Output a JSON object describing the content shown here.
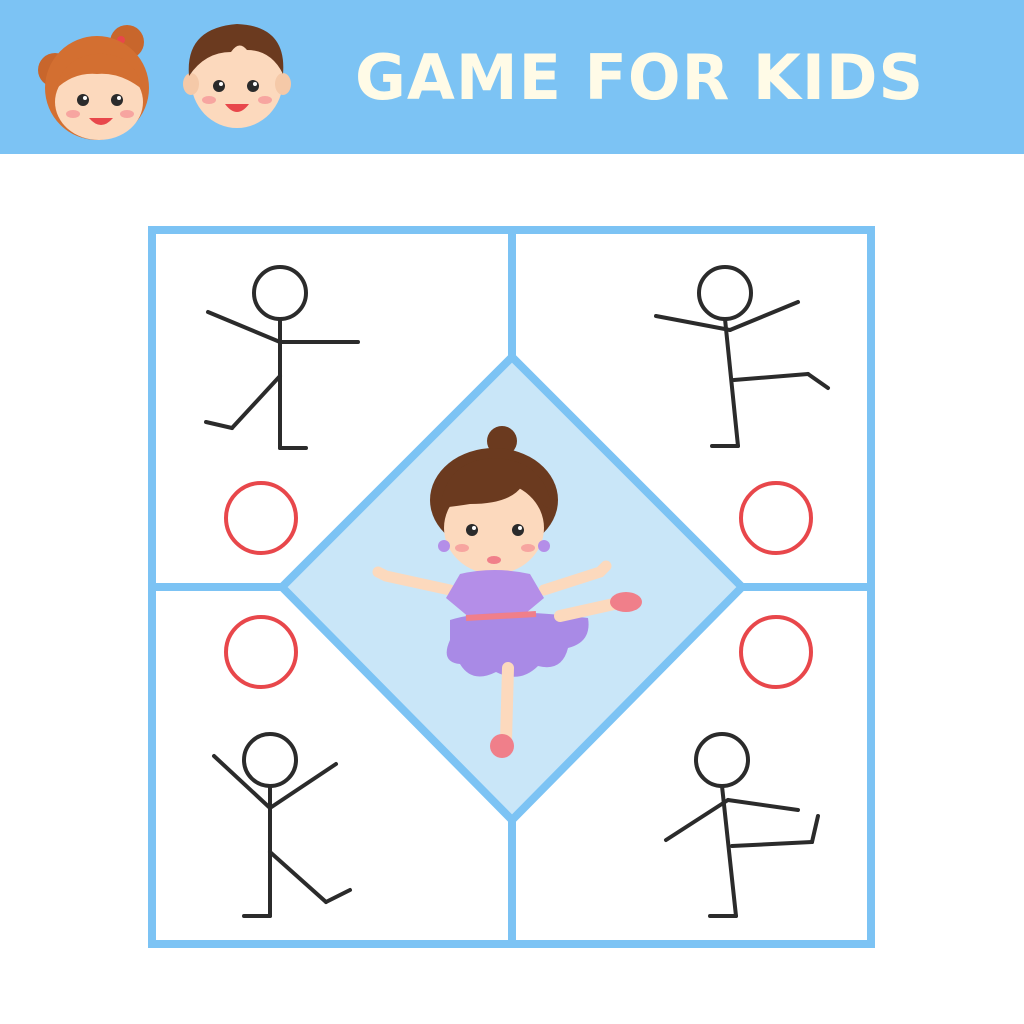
{
  "header": {
    "title": "GAME FOR KIDS",
    "mascots": [
      "girl-face",
      "boy-face"
    ],
    "background_color": "#7cc3f4",
    "title_color": "#fffbe7"
  },
  "board": {
    "frame_color": "#7cc3f4",
    "center_fill": "#c9e6f8",
    "center_character": "ballerina",
    "answer_circle_color": "#e8474b",
    "poses": [
      {
        "position": "top-left",
        "pose": "arms-out-leg-bent"
      },
      {
        "position": "top-right",
        "pose": "arms-out-leg-raised-side"
      },
      {
        "position": "bottom-left",
        "pose": "arms-up-leg-kick"
      },
      {
        "position": "bottom-right",
        "pose": "arms-out-leg-raised-front"
      }
    ]
  }
}
